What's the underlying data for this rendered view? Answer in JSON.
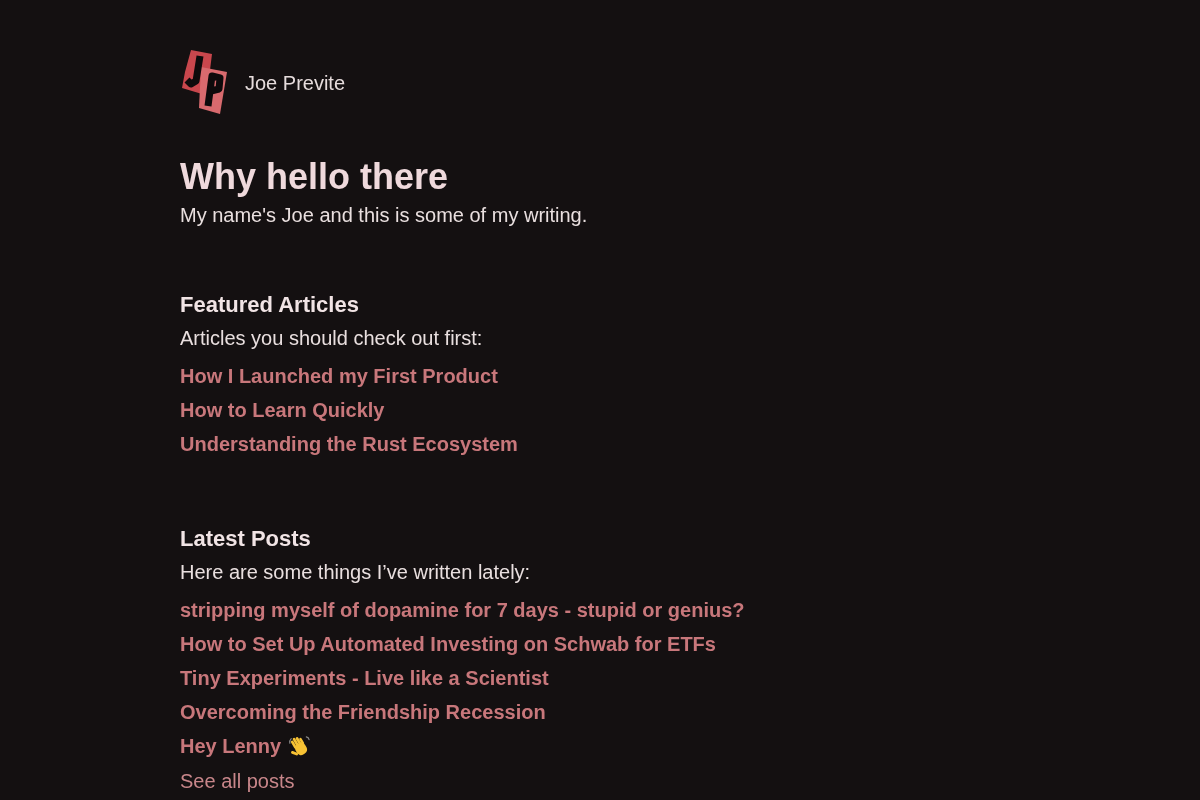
{
  "header": {
    "site_name": "Joe Previte"
  },
  "intro": {
    "title": "Why hello there",
    "text": "My name's Joe and this is some of my writing."
  },
  "sections": [
    {
      "title": "Featured Articles",
      "description": "Articles you should check out first:",
      "links": [
        {
          "title": "How I Launched my First Product",
          "kind": "plain"
        },
        {
          "title": "How to Learn Quickly",
          "kind": "plain"
        },
        {
          "title": "Understanding the Rust Ecosystem",
          "kind": "plain"
        }
      ]
    },
    {
      "title": "Latest Posts",
      "description": "Here are some things I’ve written lately:",
      "links": [
        {
          "title": "stripping myself of dopamine for 7 days - stupid or genius?",
          "kind": "plain"
        },
        {
          "title": "How to Set Up Automated Investing on Schwab for ETFs",
          "kind": "plain"
        },
        {
          "title": "Tiny Experiments - Live like a Scientist",
          "kind": "plain"
        },
        {
          "title": "Overcoming the Friendship Recession",
          "kind": "plain"
        },
        {
          "title": "Hey Lenny",
          "kind": "emoji"
        }
      ],
      "more_link": "See all posts"
    }
  ]
}
